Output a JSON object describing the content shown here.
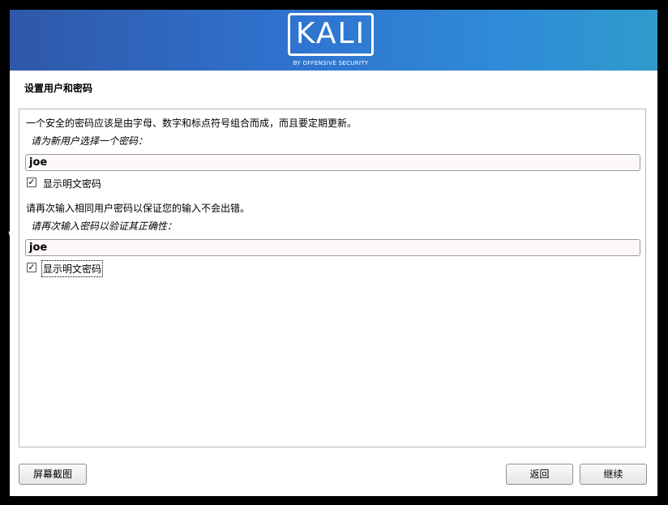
{
  "banner": {
    "logo_text": "KALI",
    "logo_subtitle": "BY OFFENSIVE SECURITY",
    "gradient_colors": [
      "#2f58a8",
      "#2f9bcc"
    ]
  },
  "page": {
    "title": "设置用户和密码"
  },
  "form": {
    "intro": "一个安全的密码应该是由字母、数字和标点符号组合而成，而且要定期更新。",
    "password_label": "请为新用户选择一个密码：",
    "password_value": "joe",
    "show_password_1": "显示明文密码",
    "repeat_intro": "请再次输入相同用户密码以保证您的输入不会出错。",
    "repeat_label": "请再次输入密码以验证其正确性：",
    "repeat_value": "joe",
    "show_password_2": "显示明文密码",
    "checkbox_1_checked": true,
    "checkbox_2_checked": true
  },
  "footer": {
    "screenshot_button": "屏幕截图",
    "back_button": "返回",
    "continue_button": "继续"
  }
}
